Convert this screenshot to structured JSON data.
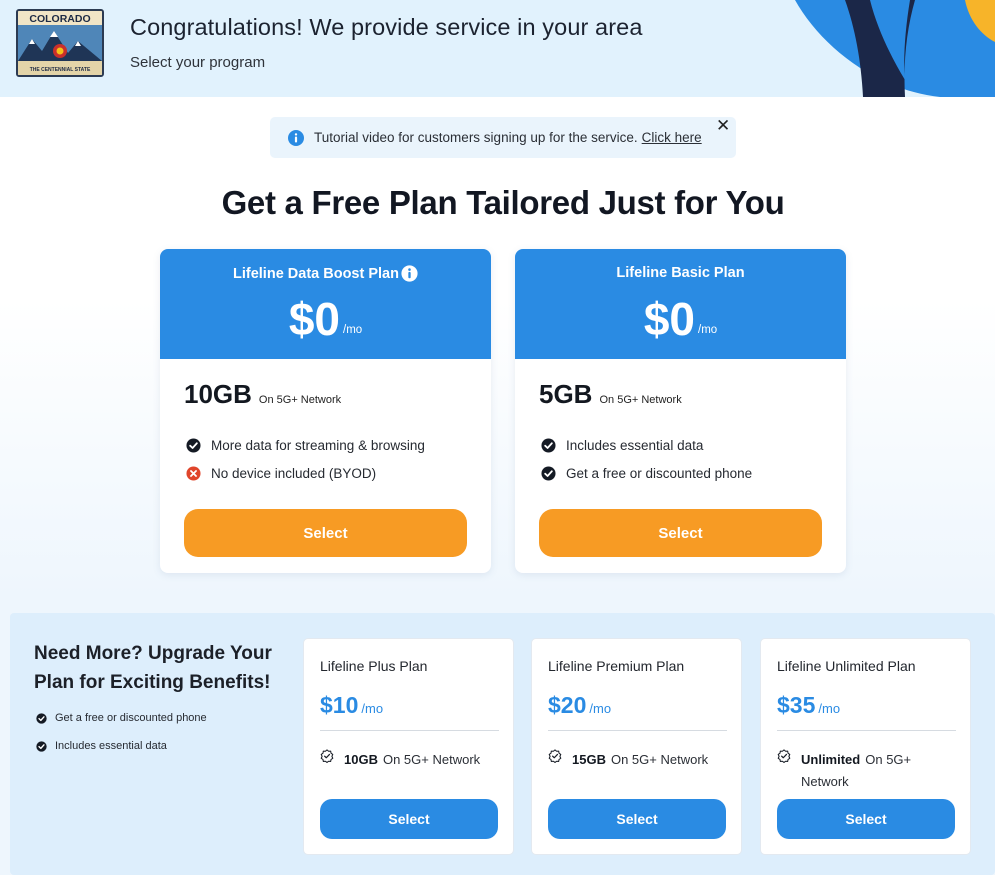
{
  "header": {
    "badge": {
      "state": "COLORADO",
      "motto": "THE CENTENNIAL STATE"
    },
    "title": "Congratulations! We provide service in your area",
    "subtitle": "Select your program"
  },
  "notice": {
    "text": "Tutorial video for customers signing up for the service.",
    "link_label": "Click here",
    "close_label": "✕"
  },
  "main_title": "Get a Free Plan Tailored Just for You",
  "free_plans": [
    {
      "name": "Lifeline Data Boost Plan",
      "price": "$0",
      "period": "/mo",
      "data": "10GB",
      "network": "On 5G+ Network",
      "features": [
        {
          "text": "More data for streaming & browsing",
          "type": "check"
        },
        {
          "text": "No device included (BYOD)",
          "type": "cross"
        }
      ],
      "button": "Select"
    },
    {
      "name": "Lifeline Basic Plan",
      "price": "$0",
      "period": "/mo",
      "data": "5GB",
      "network": "On 5G+ Network",
      "features": [
        {
          "text": "Includes essential data",
          "type": "check"
        },
        {
          "text": "Get a free or discounted phone",
          "type": "check"
        }
      ],
      "button": "Select"
    }
  ],
  "upgrade": {
    "title": "Need More? Upgrade Your Plan for Exciting Benefits!",
    "features": [
      "Get a free or discounted phone",
      "Includes essential data"
    ],
    "plans": [
      {
        "name": "Lifeline Plus Plan",
        "price": "$10",
        "period": "/mo",
        "data": "10GB",
        "network": "On 5G+ Network",
        "button": "Select"
      },
      {
        "name": "Lifeline Premium Plan",
        "price": "$20",
        "period": "/mo",
        "data": "15GB",
        "network": "On 5G+ Network",
        "button": "Select"
      },
      {
        "name": "Lifeline Unlimited Plan",
        "price": "$35",
        "period": "/mo",
        "data": "Unlimited",
        "network": "On 5G+ Network",
        "button": "Select"
      }
    ]
  },
  "colors": {
    "primary_blue": "#2a8be3",
    "select_orange": "#f79b24",
    "header_bg": "#e1f2fd",
    "error_red": "#e0452b"
  }
}
